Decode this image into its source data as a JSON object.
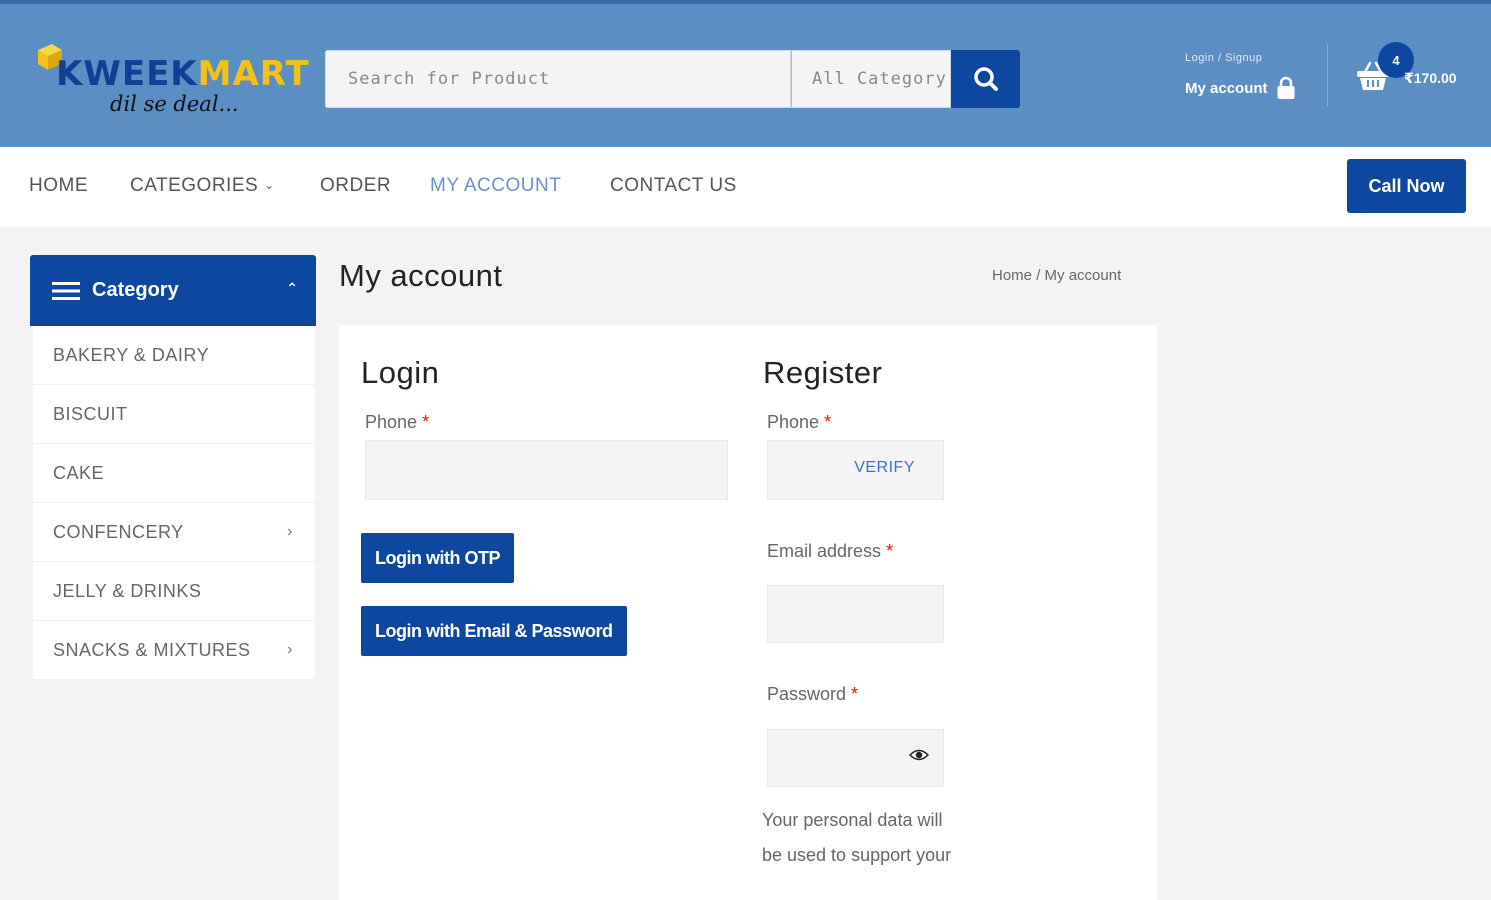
{
  "header": {
    "logo": {
      "name_part1": "KWEEK",
      "name_part2": "MART",
      "tagline": "dil se deal..."
    },
    "search": {
      "placeholder": "Search for Product",
      "category": "All Category"
    },
    "account": {
      "small": "Login / Signup",
      "label": "My account"
    },
    "cart": {
      "count": "4",
      "total": "₹170.00"
    }
  },
  "nav": {
    "items": [
      {
        "label": "HOME"
      },
      {
        "label": "CATEGORIES"
      },
      {
        "label": "ORDER"
      },
      {
        "label": "MY ACCOUNT"
      },
      {
        "label": "CONTACT US"
      }
    ],
    "call_now": "Call Now"
  },
  "sidebar": {
    "title": "Category",
    "items": [
      {
        "label": "BAKERY & DAIRY"
      },
      {
        "label": "BISCUIT"
      },
      {
        "label": "CAKE"
      },
      {
        "label": "CONFENCERY"
      },
      {
        "label": "JELLY & DRINKS"
      },
      {
        "label": "SNACKS & MIXTURES"
      }
    ]
  },
  "page": {
    "title": "My account",
    "breadcrumb": {
      "home": "Home",
      "sep": "/",
      "current": "My account"
    }
  },
  "login": {
    "title": "Login",
    "phone_label": "Phone",
    "otp_button": "Login with OTP",
    "email_button": "Login with Email & Password"
  },
  "register": {
    "title": "Register",
    "phone_label": "Phone",
    "verify": "VERIFY",
    "email_label": "Email address",
    "password_label": "Password",
    "privacy": "Your personal data will be used to support your"
  },
  "required_mark": "*",
  "colors": {
    "header_bg": "#5b8ec3",
    "brand_blue": "#0e47a0",
    "logo_yellow": "#f2c21a",
    "active_nav": "#6d8fd1"
  }
}
